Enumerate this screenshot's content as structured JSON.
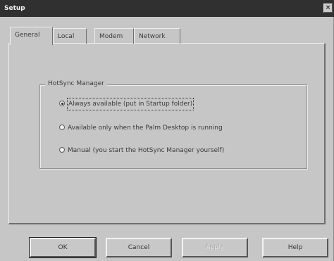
{
  "window": {
    "title": "Setup",
    "close_glyph": "×"
  },
  "tabs": [
    {
      "label": "General",
      "active": true
    },
    {
      "label": "Local",
      "active": false
    },
    {
      "label": "Modem",
      "active": false
    },
    {
      "label": "Network",
      "active": false
    }
  ],
  "hotsync_group": {
    "title": "HotSync Manager",
    "options": [
      {
        "label": "Always available (put in Startup folder)",
        "selected": true
      },
      {
        "label": "Available only when the Palm Desktop is running",
        "selected": false
      },
      {
        "label": "Manual (you start the HotSync Manager yourself)",
        "selected": false
      }
    ]
  },
  "buttons": {
    "ok": "OK",
    "cancel": "Cancel",
    "apply": "Apply",
    "help": "Help"
  }
}
